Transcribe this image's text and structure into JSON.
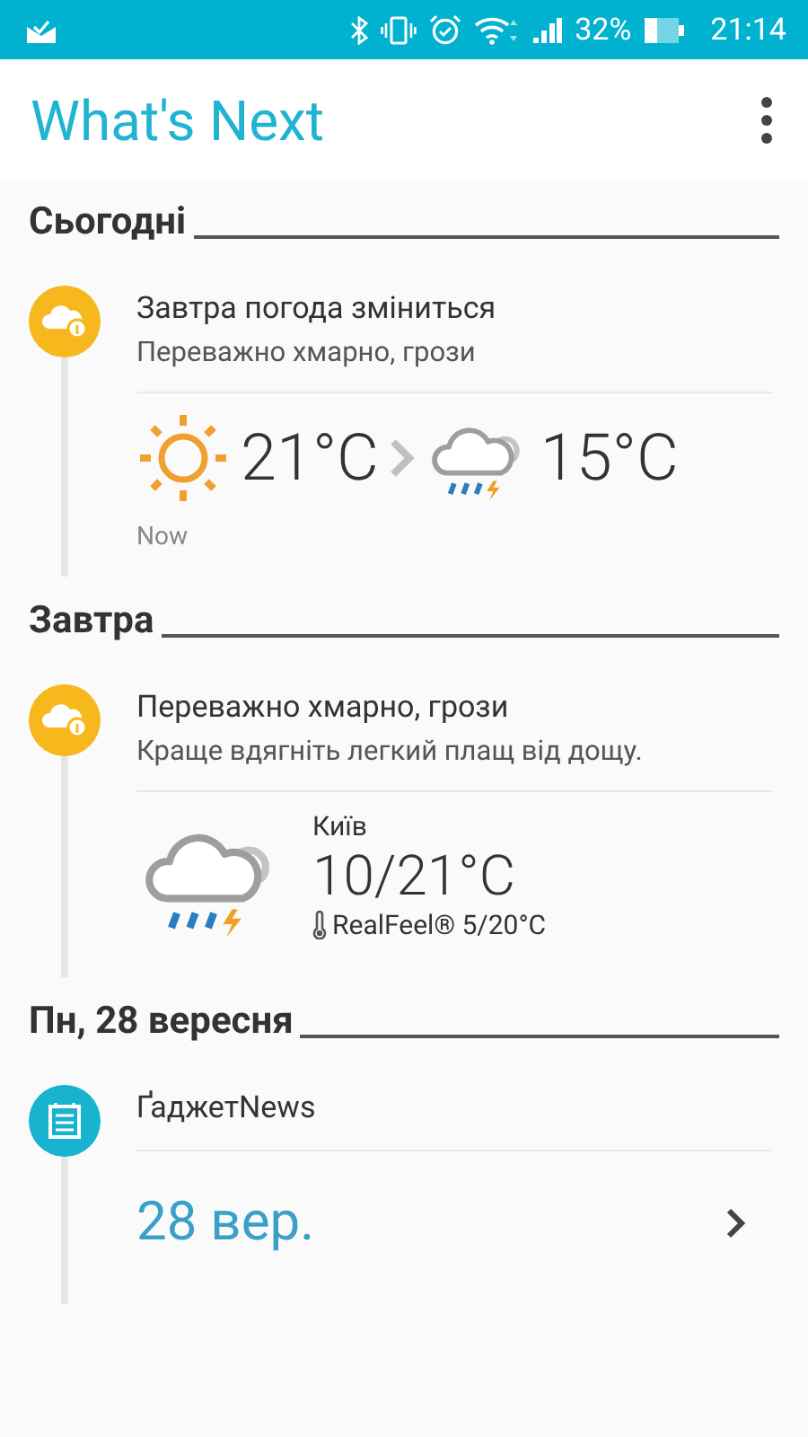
{
  "status_bar": {
    "battery": "32%",
    "time": "21:14"
  },
  "app_bar": {
    "title": "What's Next"
  },
  "sections": [
    {
      "heading": "Сьогодні",
      "card": {
        "kind": "weather_change",
        "title": "Завтра погода зміниться",
        "subtitle": "Переважно хмарно, грози",
        "from_temp": "21°C",
        "to_temp": "15°C",
        "time": "Now"
      }
    },
    {
      "heading": "Завтра",
      "card": {
        "kind": "weather_forecast",
        "title": "Переважно хмарно, грози",
        "subtitle": "Краще вдягніть легкий плащ від дощу.",
        "city": "Київ",
        "temp": "10/21°C",
        "realfeel": "RealFeel® 5/20°C"
      }
    },
    {
      "heading": "Пн, 28 вересня",
      "card": {
        "kind": "calendar",
        "title": "ҐаджетNews",
        "date": "28 вер."
      }
    }
  ]
}
